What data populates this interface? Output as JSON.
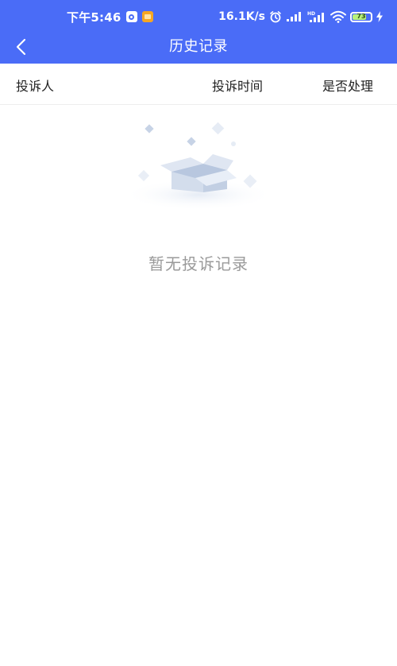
{
  "status_bar": {
    "time": "下午5:46",
    "network_speed": "16.1K/s",
    "battery_level": "73",
    "icons": [
      "app-notification-icon",
      "app-notification-icon",
      "alarm-icon",
      "signal-icon",
      "signal-hd-icon",
      "wifi-icon",
      "battery-icon",
      "charging-icon"
    ]
  },
  "nav": {
    "title": "历史记录",
    "back_icon": "chevron-left-icon"
  },
  "table": {
    "columns": [
      "投诉人",
      "投诉时间",
      "是否处理"
    ]
  },
  "empty_state": {
    "icon": "empty-box-icon",
    "message": "暂无投诉记录"
  },
  "colors": {
    "primary": "#4a6cf7",
    "text": "#222222",
    "muted": "#9a9a9a",
    "divider": "#eeeeee"
  }
}
